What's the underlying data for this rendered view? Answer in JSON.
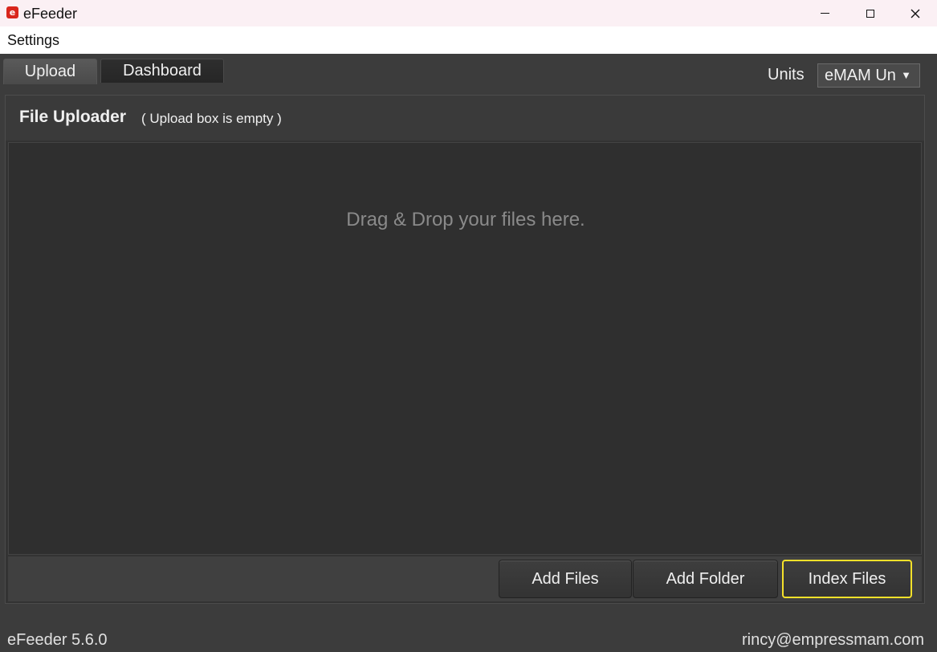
{
  "window": {
    "title": "eFeeder",
    "logo_letter": "e",
    "accent": "#d9261c"
  },
  "menu": {
    "settings_label": "Settings"
  },
  "tabs": [
    {
      "label": "Upload",
      "active": true
    },
    {
      "label": "Dashboard",
      "active": false
    }
  ],
  "units": {
    "label": "Units",
    "selected": "eMAM Un"
  },
  "uploader": {
    "title": "File Uploader",
    "status": "( Upload box is empty )",
    "drop_hint": "Drag & Drop your files here."
  },
  "actions": {
    "add_files": "Add Files",
    "add_folder": "Add Folder",
    "index_files": "Index Files",
    "highlight_color": "#f5e12a"
  },
  "footer": {
    "version": "eFeeder 5.6.0",
    "user": "rincy@empressmam.com"
  }
}
